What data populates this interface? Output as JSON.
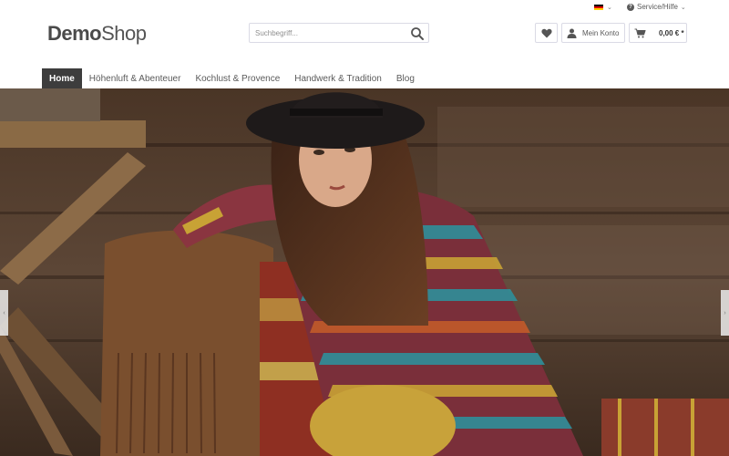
{
  "topbar": {
    "language_flag": [
      "#000000",
      "#dd0000",
      "#ffce00"
    ],
    "service_label": "Service/Hilfe"
  },
  "logo": {
    "bold": "Demo",
    "light": "Shop"
  },
  "search": {
    "placeholder": "Suchbegriff..."
  },
  "header": {
    "account_label": "Mein Konto",
    "cart_amount": "0,00 € *"
  },
  "nav": {
    "items": [
      {
        "label": "Home",
        "active": true
      },
      {
        "label": "Höhenluft & Abenteuer"
      },
      {
        "label": "Kochlust & Provence"
      },
      {
        "label": "Handwerk & Tradition"
      },
      {
        "label": "Blog"
      }
    ]
  },
  "colors": {
    "nav_active_bg": "#3d3d3d",
    "border": "#dadae5"
  }
}
